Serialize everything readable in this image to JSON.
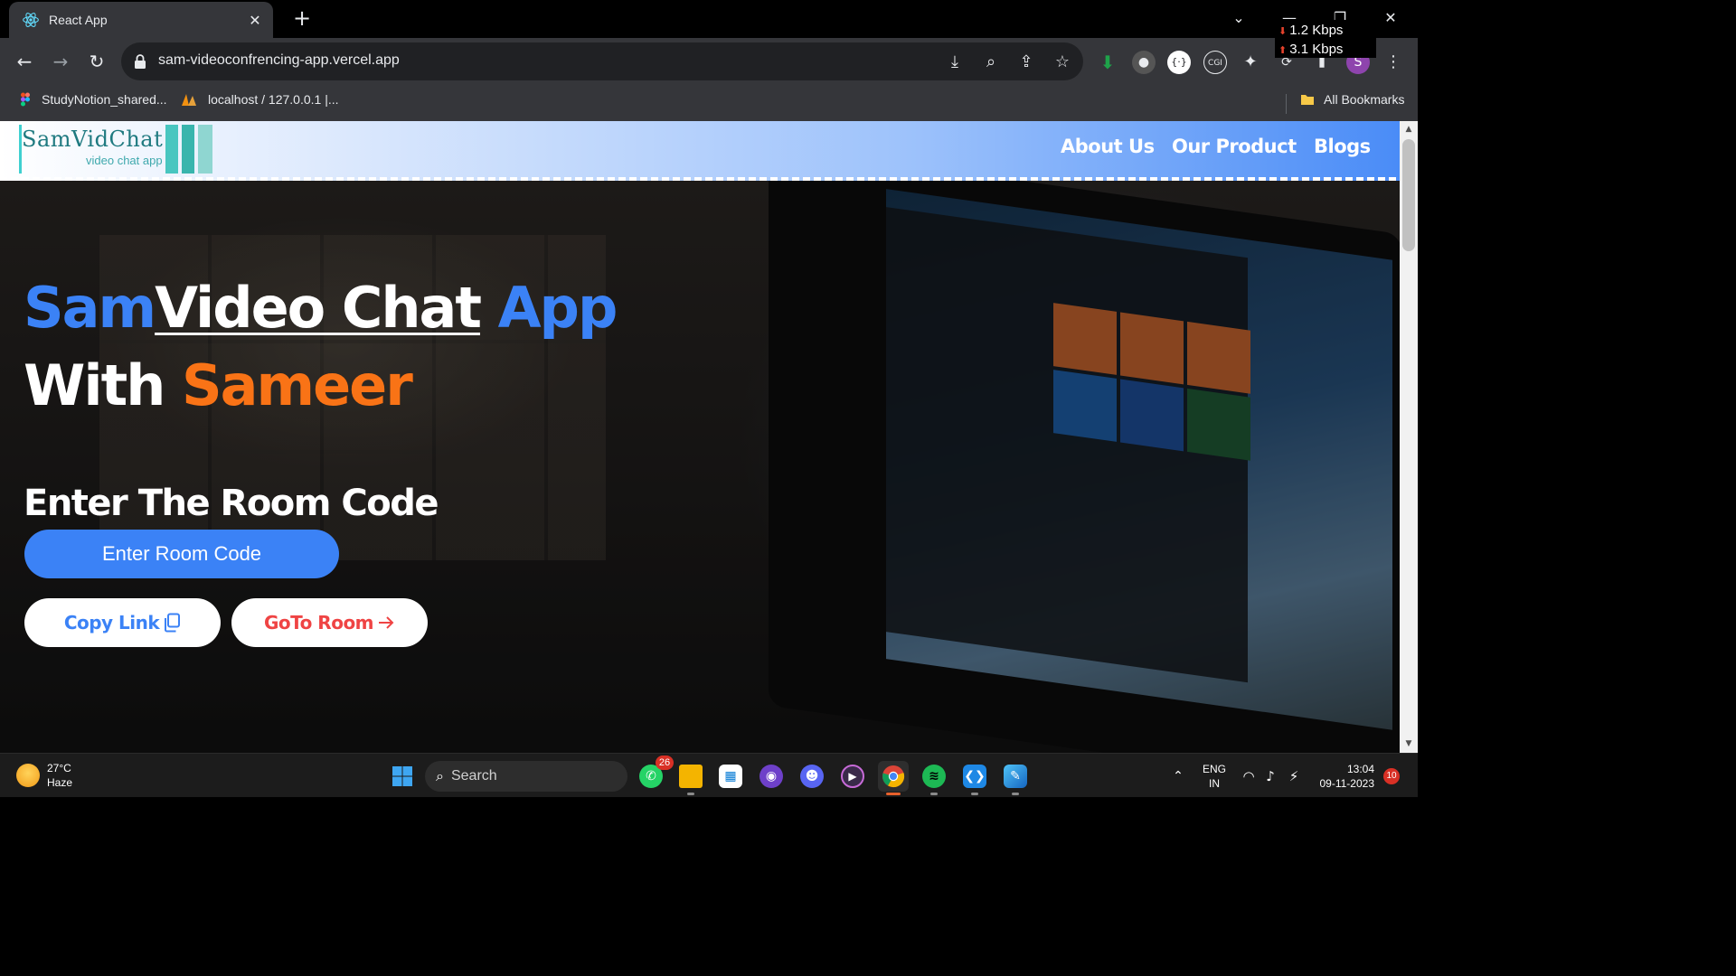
{
  "browser": {
    "tab_title": "React App",
    "tab_close": "✕",
    "new_tab": "+",
    "url": "sam-videoconfrencing-app.vercel.app",
    "net_down": "1.2 Kbps",
    "net_up": "3.1 Kbps",
    "profile_initial": "S",
    "bookmarks": [
      {
        "label": "StudyNotion_shared...",
        "icon": "figma-icon"
      },
      {
        "label": "localhost / 127.0.0.1 |...",
        "icon": "phpmyadmin-icon"
      }
    ],
    "all_bookmarks": "All Bookmarks"
  },
  "site": {
    "logo_title": "SamVidChat",
    "logo_subtitle": "video chat app",
    "nav": [
      "About Us",
      "Our Product",
      "Blogs"
    ],
    "hero": {
      "sam": "Sam",
      "video_chat": "Video Chat",
      "app": "App",
      "with": "With",
      "sameer": "Sameer"
    },
    "room_heading": "Enter The Room Code",
    "room_placeholder": "Enter Room Code",
    "copy_link": "Copy Link",
    "goto_room": "GoTo Room",
    "colors": {
      "blue": "#3b82f6",
      "orange": "#f97316",
      "red": "#ef4444"
    }
  },
  "taskbar": {
    "temperature": "27°C",
    "condition": "Haze",
    "search_label": "Search",
    "whatsapp_badge": "26",
    "lang_top": "ENG",
    "lang_bottom": "IN",
    "time": "13:04",
    "date": "09-11-2023",
    "notifications": "10",
    "apps": [
      "whatsapp-icon",
      "file-explorer-icon",
      "microsoft-store-icon",
      "github-desktop-icon",
      "discord-icon",
      "media-player-icon",
      "chrome-icon",
      "spotify-icon",
      "vscode-icon",
      "paint-icon"
    ]
  }
}
